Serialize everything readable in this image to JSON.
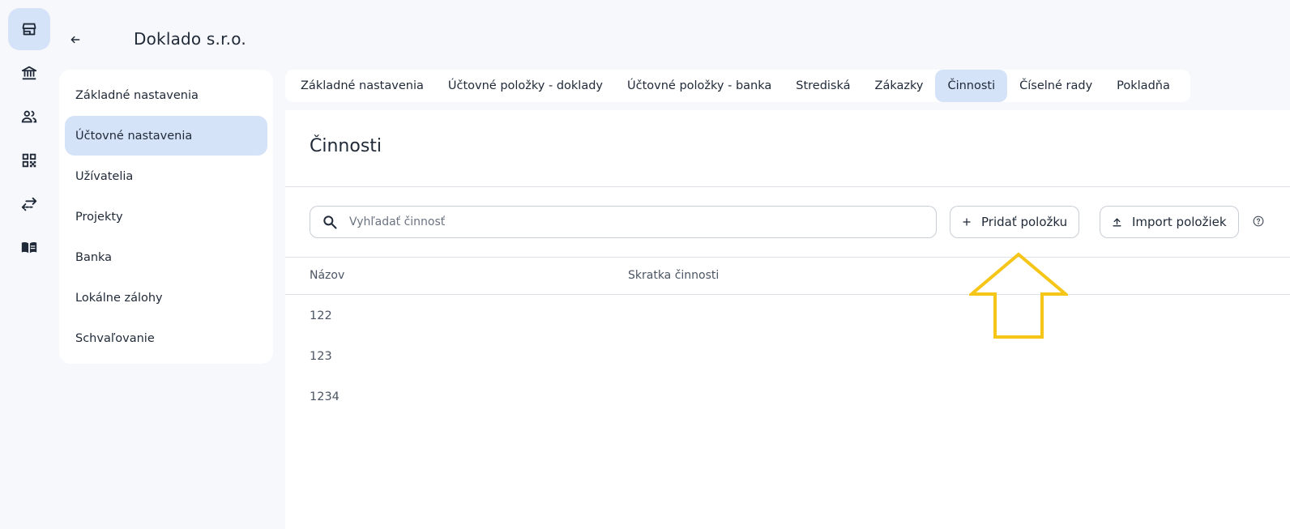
{
  "rail": {
    "items": [
      {
        "icon": "store-icon",
        "active": true
      },
      {
        "icon": "bank-icon",
        "active": false
      },
      {
        "icon": "people-icon",
        "active": false
      },
      {
        "icon": "qr-code-icon",
        "active": false
      },
      {
        "icon": "swap-arrows-icon",
        "active": false
      },
      {
        "icon": "book-icon",
        "active": false
      }
    ]
  },
  "header": {
    "company_name": "Doklado s.r.o."
  },
  "settings_nav": {
    "items": [
      {
        "label": "Základné nastavenia"
      },
      {
        "label": "Účtovné nastavenia"
      },
      {
        "label": "Užívatelia"
      },
      {
        "label": "Projekty"
      },
      {
        "label": "Banka"
      },
      {
        "label": "Lokálne zálohy"
      },
      {
        "label": "Schvaľovanie"
      }
    ],
    "active_index": 1
  },
  "tabs": {
    "items": [
      {
        "label": "Základné nastavenia"
      },
      {
        "label": "Účtovné položky - doklady"
      },
      {
        "label": "Účtovné položky - banka"
      },
      {
        "label": "Strediská"
      },
      {
        "label": "Zákazky"
      },
      {
        "label": "Činnosti"
      },
      {
        "label": "Číselné rady"
      },
      {
        "label": "Pokladňa"
      }
    ],
    "active_index": 5
  },
  "main": {
    "title": "Činnosti",
    "search_placeholder": "Vyhľadať činnosť",
    "search_value": "",
    "add_button_label": "Pridať položku",
    "import_button_label": "Import položiek",
    "columns": [
      "Názov",
      "Skratka činnosti"
    ],
    "rows": [
      {
        "name": "122",
        "short": ""
      },
      {
        "name": "123",
        "short": ""
      },
      {
        "name": "1234",
        "short": ""
      }
    ]
  },
  "colors": {
    "active_bg": "#d5e3f9",
    "annotation_arrow": "#f5c518"
  }
}
